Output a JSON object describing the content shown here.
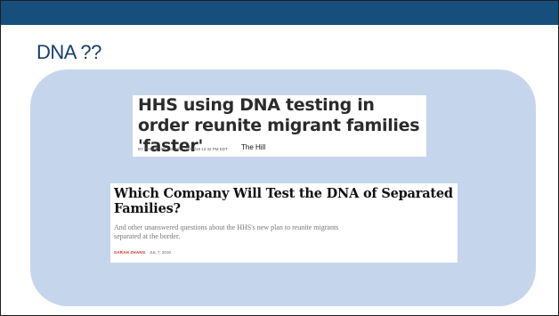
{
  "slide": {
    "title": "DNA ??",
    "colors": {
      "top_bar": "#174f7c",
      "panel": "#c5d5ec",
      "title": "#173f6c"
    }
  },
  "clippings": {
    "hill": {
      "headline": "HHS using DNA testing in order reunite migrant families 'faster'",
      "byline": "BY JESSIE HELLMANN - 07/05/18 12:32 PM EDT",
      "source": "The Hill"
    },
    "atlantic": {
      "headline": "Which Company Will Test the DNA of Separated Families?",
      "dek": "And other unanswered questions about the HHS's new plan to reunite migrants separated at the border.",
      "author": "SARAH ZHANG",
      "date": "JUL 7, 2018"
    }
  }
}
